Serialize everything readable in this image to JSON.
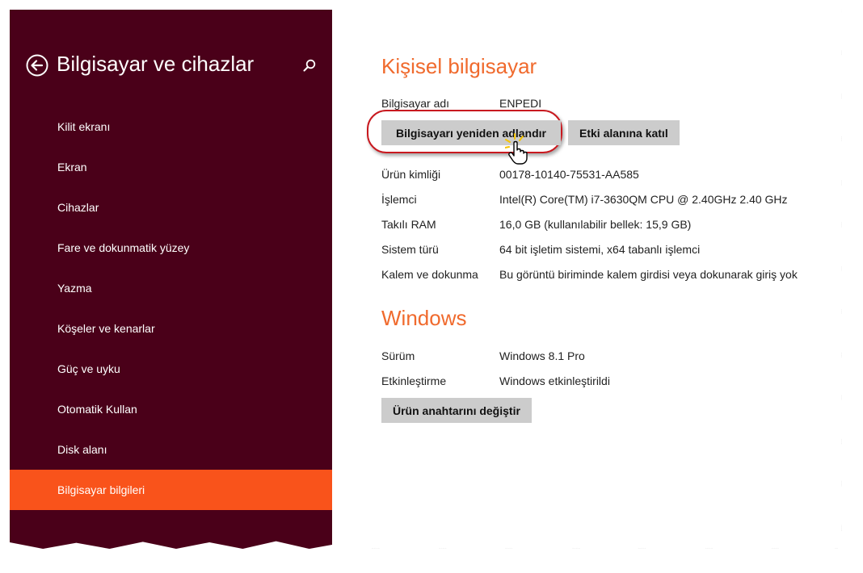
{
  "sidebar": {
    "title": "Bilgisayar ve cihazlar",
    "items": [
      {
        "label": "Kilit ekranı",
        "active": false
      },
      {
        "label": "Ekran",
        "active": false
      },
      {
        "label": "Cihazlar",
        "active": false
      },
      {
        "label": "Fare ve dokunmatik yüzey",
        "active": false
      },
      {
        "label": "Yazma",
        "active": false
      },
      {
        "label": "Köşeler ve kenarlar",
        "active": false
      },
      {
        "label": "Güç ve uyku",
        "active": false
      },
      {
        "label": "Otomatik Kullan",
        "active": false
      },
      {
        "label": "Disk alanı",
        "active": false
      },
      {
        "label": "Bilgisayar bilgileri",
        "active": true
      }
    ]
  },
  "pc": {
    "title": "Kişisel bilgisayar",
    "name_label": "Bilgisayar adı",
    "name_value": "ENPEDI",
    "rename_button": "Bilgisayarı yeniden adlandır",
    "join_domain_button": "Etki alanına katıl",
    "rows": [
      {
        "label": "Ürün kimliği",
        "value": "00178-10140-75531-AA585"
      },
      {
        "label": "İşlemci",
        "value": "Intel(R) Core(TM) i7-3630QM CPU @ 2.40GHz   2.40 GHz"
      },
      {
        "label": "Takılı RAM",
        "value": "16,0 GB (kullanılabilir bellek: 15,9 GB)"
      },
      {
        "label": "Sistem türü",
        "value": "64 bit işletim sistemi, x64 tabanlı işlemci"
      },
      {
        "label": "Kalem ve dokunma",
        "value": "Bu görüntü biriminde kalem girdisi veya dokunarak giriş yok"
      }
    ]
  },
  "windows": {
    "title": "Windows",
    "rows": [
      {
        "label": "Sürüm",
        "value": "Windows 8.1 Pro"
      },
      {
        "label": "Etkinleştirme",
        "value": "Windows etkinleştirildi"
      }
    ],
    "change_key_button": "Ürün anahtarını değiştir"
  },
  "colors": {
    "sidebar_bg": "#4a0019",
    "accent": "#f9531b",
    "section_title": "#f06a2d",
    "button_bg": "#cccccc",
    "highlight_ring": "#c8191f"
  },
  "icons": [
    "back-arrow-icon",
    "search-icon",
    "hand-cursor-icon"
  ]
}
